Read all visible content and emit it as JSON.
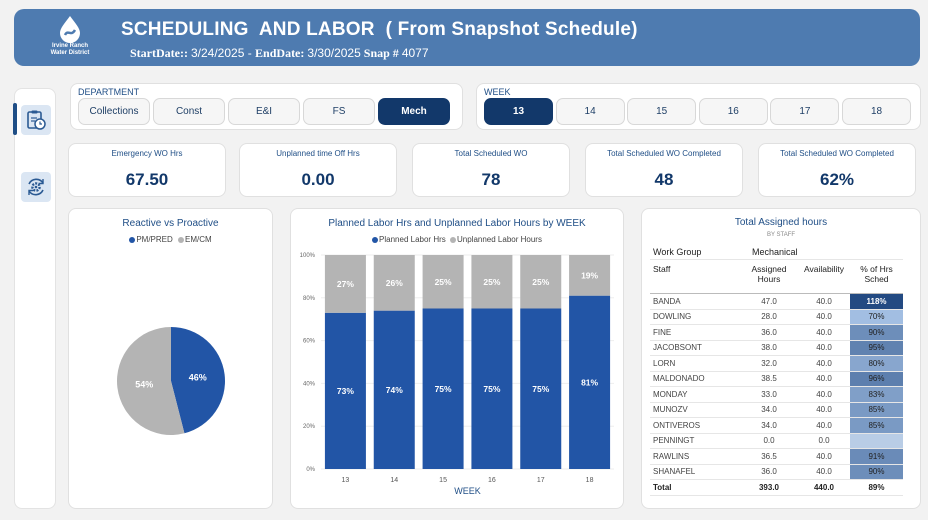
{
  "header": {
    "org_line1": "Irvine Ranch",
    "org_line2": "Water District",
    "title": "SCHEDULING  AND LABOR  ( From Snapshot Schedule)",
    "start_label": "StartDate:: ",
    "start_value": "3/24/2025",
    "sep": " - ",
    "end_label": "EndDate: ",
    "end_value": "3/30/2025",
    "snap_label": "Snap # ",
    "snap_value": "4077"
  },
  "sidebar": [
    {
      "icon": "clipboard-clock-icon",
      "active": true
    },
    {
      "icon": "gear-sync-icon",
      "active": false
    }
  ],
  "department": {
    "label": "DEPARTMENT",
    "options": [
      "Collections",
      "Const",
      "E&I",
      "FS",
      "Mech"
    ],
    "selected": "Mech"
  },
  "week": {
    "label": "WEEK",
    "options": [
      "13",
      "14",
      "15",
      "16",
      "17",
      "18"
    ],
    "selected": "13"
  },
  "kpis": [
    {
      "label": "Emergency WO Hrs",
      "value": "67.50"
    },
    {
      "label": "Unplanned time Off Hrs",
      "value": "0.00"
    },
    {
      "label": "Total Scheduled WO",
      "value": "78"
    },
    {
      "label": "Total Scheduled WO Completed",
      "value": "48"
    },
    {
      "label": "Total Scheduled WO Completed",
      "value": "62%"
    }
  ],
  "colors": {
    "header": "#4e7bb0",
    "accent": "#12386a",
    "planned": "#2255a6",
    "unplanned": "#b4b4b4"
  },
  "chart_data": [
    {
      "type": "pie",
      "title": "Reactive vs Proactive",
      "legend": [
        "PM/PRED",
        "EM/CM"
      ],
      "slices": [
        {
          "name": "PM/PRED",
          "value": 46,
          "label": "46%"
        },
        {
          "name": "EM/CM",
          "value": 54,
          "label": "54%"
        }
      ]
    },
    {
      "type": "bar",
      "stacked": true,
      "title": "Planned Labor Hrs and Unplanned Labor Hours by WEEK",
      "xlabel": "WEEK",
      "categories": [
        "13",
        "14",
        "15",
        "16",
        "17",
        "18"
      ],
      "yticks": [
        "0%",
        "20%",
        "40%",
        "60%",
        "80%",
        "100%"
      ],
      "ylim": [
        0,
        100
      ],
      "series": [
        {
          "name": "Planned Labor Hrs",
          "values": [
            73,
            74,
            75,
            75,
            75,
            81
          ]
        },
        {
          "name": "Unplanned Labor Hours",
          "values": [
            27,
            26,
            25,
            25,
            25,
            19
          ]
        }
      ]
    }
  ],
  "staff_table": {
    "title": "Total Assigned hours",
    "subtitle": "BY STAFF",
    "group_label": "Work Group",
    "group_value": "Mechanical",
    "headers": [
      "Staff",
      "Assigned Hours",
      "Availability",
      "% of Hrs Sched"
    ],
    "rows": [
      {
        "name": "BANDA",
        "assigned": "47.0",
        "avail": "40.0",
        "pct": "118%",
        "level": 1.18
      },
      {
        "name": "DOWLING",
        "assigned": "28.0",
        "avail": "40.0",
        "pct": "70%",
        "level": 0.7
      },
      {
        "name": "FINE",
        "assigned": "36.0",
        "avail": "40.0",
        "pct": "90%",
        "level": 0.9
      },
      {
        "name": "JACOBSONT",
        "assigned": "38.0",
        "avail": "40.0",
        "pct": "95%",
        "level": 0.95
      },
      {
        "name": "LORN",
        "assigned": "32.0",
        "avail": "40.0",
        "pct": "80%",
        "level": 0.8
      },
      {
        "name": "MALDONADO",
        "assigned": "38.5",
        "avail": "40.0",
        "pct": "96%",
        "level": 0.96
      },
      {
        "name": "MONDAY",
        "assigned": "33.0",
        "avail": "40.0",
        "pct": "83%",
        "level": 0.83
      },
      {
        "name": "MUNOZV",
        "assigned": "34.0",
        "avail": "40.0",
        "pct": "85%",
        "level": 0.85
      },
      {
        "name": "ONTIVEROS",
        "assigned": "34.0",
        "avail": "40.0",
        "pct": "85%",
        "level": 0.85
      },
      {
        "name": "PENNINGT",
        "assigned": "0.0",
        "avail": "0.0",
        "pct": "",
        "level": 0
      },
      {
        "name": "RAWLINS",
        "assigned": "36.5",
        "avail": "40.0",
        "pct": "91%",
        "level": 0.91
      },
      {
        "name": "SHANAFEL",
        "assigned": "36.0",
        "avail": "40.0",
        "pct": "90%",
        "level": 0.9
      }
    ],
    "total": {
      "name": "Total",
      "assigned": "393.0",
      "avail": "440.0",
      "pct": "89%"
    }
  }
}
